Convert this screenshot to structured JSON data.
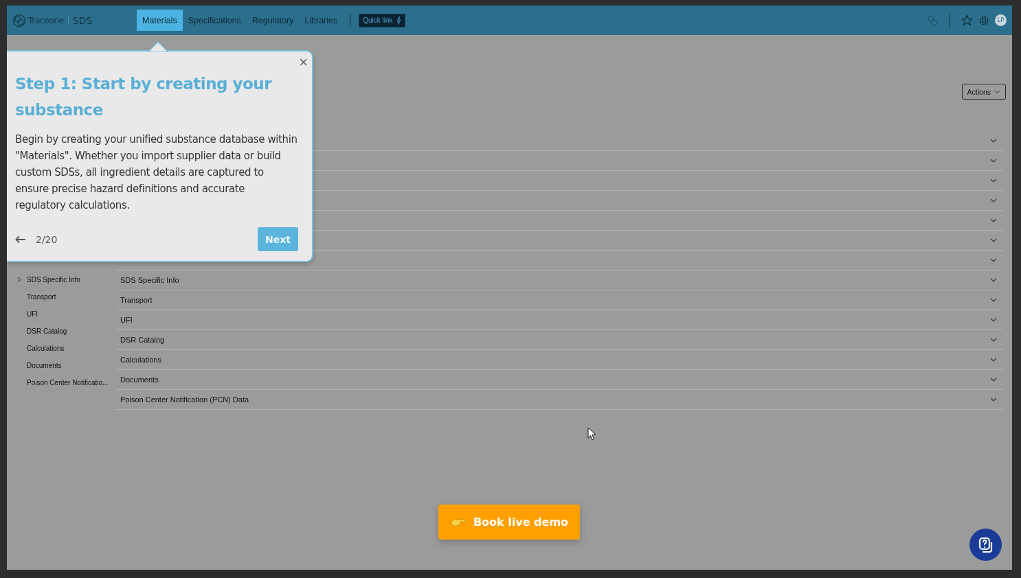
{
  "brand": {
    "name": "Traceone",
    "product": "SDS"
  },
  "nav": [
    {
      "label": "Materials",
      "selected": true
    },
    {
      "label": "Specifications",
      "selected": false
    },
    {
      "label": "Regulatory",
      "selected": false
    },
    {
      "label": "Libraries",
      "selected": false
    }
  ],
  "quick_link": "Quick link",
  "user_initials": "LP",
  "actions_button": "Actions",
  "sidebar": [
    {
      "label": "SDS Specific Info",
      "expandable": true
    },
    {
      "label": "Transport",
      "expandable": false
    },
    {
      "label": "UFI",
      "expandable": false
    },
    {
      "label": "DSR Catalog",
      "expandable": false
    },
    {
      "label": "Calculations",
      "expandable": false
    },
    {
      "label": "Documents",
      "expandable": false
    },
    {
      "label": "Poison Center Notificatio...",
      "expandable": false
    }
  ],
  "sections": [
    {
      "expanded": false
    },
    {
      "expanded": false
    },
    {
      "expanded": false
    },
    {
      "expanded": false
    },
    {
      "expanded": false
    },
    {
      "expanded": false
    },
    {
      "expanded": false
    },
    {
      "expanded": false,
      "label": "SDS Specific Info"
    },
    {
      "expanded": false,
      "label": "Transport"
    },
    {
      "expanded": false,
      "label": "UFI"
    },
    {
      "expanded": false,
      "label": "DSR Catalog"
    },
    {
      "expanded": false,
      "label": "Calculations"
    },
    {
      "expanded": false,
      "label": "Documents"
    },
    {
      "expanded": false,
      "label": "Poison Center Notification (PCN) Data"
    }
  ],
  "tour": {
    "title": "Step 1: Start by creating your substance",
    "body": "Begin by creating your unified substance database within \"Materials\". Whether you import supplier data or build custom SDSs, all ingredient details are captured to ensure precise hazard definitions and accurate regulatory calculations.",
    "progress": "2/20",
    "next": "Next",
    "close": "×"
  },
  "demo_button": "Book live demo"
}
